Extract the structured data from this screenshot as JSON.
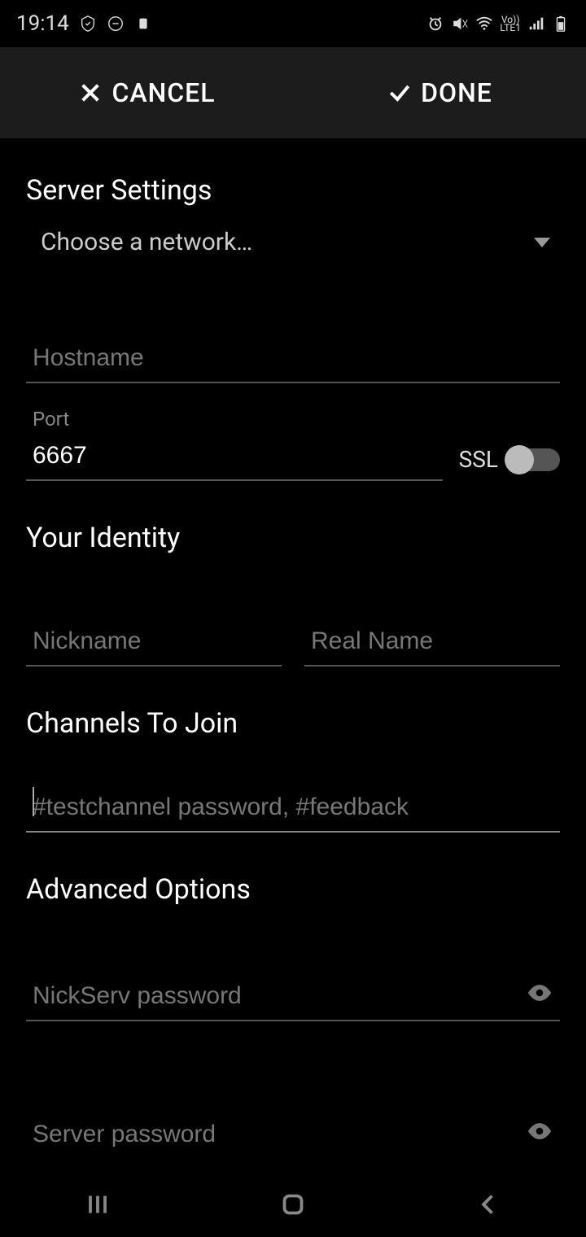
{
  "status": {
    "time": "19:14"
  },
  "actions": {
    "cancel": "CANCEL",
    "done": "DONE"
  },
  "server": {
    "title": "Server Settings",
    "network_placeholder": "Choose a network…",
    "hostname_placeholder": "Hostname",
    "port_label": "Port",
    "port_value": "6667",
    "ssl_label": "SSL"
  },
  "identity": {
    "title": "Your Identity",
    "nickname_placeholder": "Nickname",
    "realname_placeholder": "Real Name"
  },
  "channels": {
    "title": "Channels To Join",
    "placeholder": "#testchannel password, #feedback"
  },
  "advanced": {
    "title": "Advanced Options",
    "nickserv_placeholder": "NickServ password",
    "server_pw_placeholder": "Server password"
  }
}
